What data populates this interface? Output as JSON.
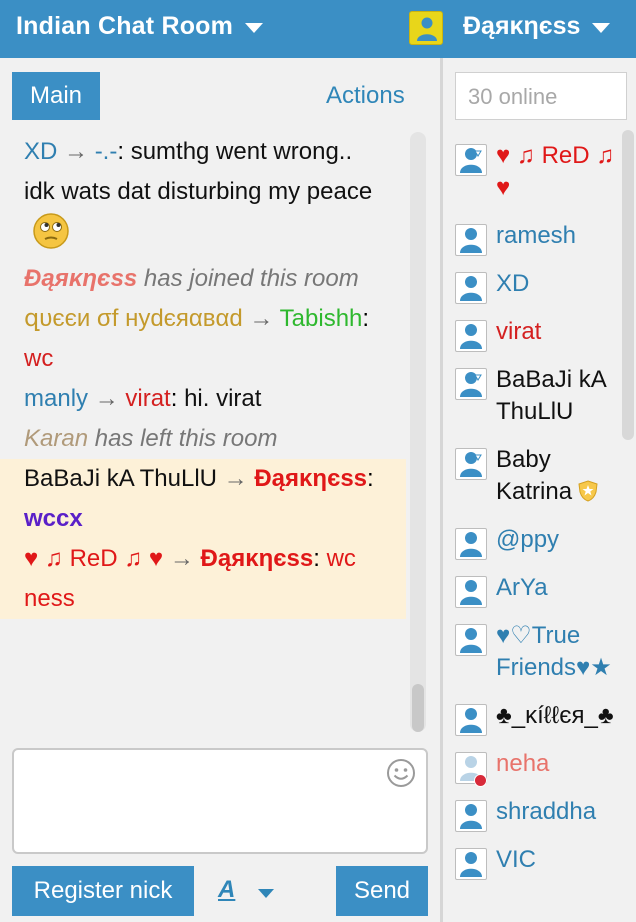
{
  "header": {
    "room_title": "Indian Chat Room",
    "user_name": "Ɖąяκηєѕѕ"
  },
  "tabs": {
    "main": "Main",
    "actions": "Actions"
  },
  "messages": [
    {
      "type": "chat",
      "from": "XD",
      "from_color": "#2f7fb0",
      "to": "-.-",
      "to_color": "#2f7fb0",
      "text": "sumthg went wrong.. idk wats dat disturbing my peace",
      "text_color": "#111111",
      "emoji": "rolling-eyes-emoji"
    },
    {
      "type": "join",
      "nick": "Ɖąяκηєѕѕ",
      "nick_color": "#e8736b",
      "text": "has joined this room"
    },
    {
      "type": "chat",
      "from": "զυєєи σf нуdєяαвαd",
      "from_color": "#c49a2c",
      "to": "Tabishh",
      "to_color": "#2eb82e",
      "text": "wc",
      "text_color": "#d42020"
    },
    {
      "type": "chat",
      "from": "manly",
      "from_color": "#2f7fb0",
      "to": "virat",
      "to_color": "#d42020",
      "text": "hi. virat",
      "text_color": "#111111"
    },
    {
      "type": "leave",
      "nick": "Karan",
      "nick_color": "#b09a7a",
      "text": "has left this room"
    },
    {
      "type": "chat",
      "highlight": true,
      "from": "BaBaJi kA ThuLlU",
      "from_color": "#111111",
      "to": "Ɖąяκηєѕѕ",
      "to_color": "#e01818",
      "text": "wccx",
      "text_color": "#5a20c8"
    },
    {
      "type": "chat",
      "highlight": true,
      "from": "♥ ♫ ReD ♫ ♥",
      "from_color": "#e01818",
      "to": "Ɖąяκηєѕѕ",
      "to_color": "#e01818",
      "text": "wc ness",
      "text_color": "#e01818"
    }
  ],
  "composer": {
    "register_label": "Register nick",
    "format_label": "A",
    "send_label": "Send"
  },
  "online": {
    "placeholder": "30 online"
  },
  "users": [
    {
      "name": "♥ ♫ ReD ♫ ♥",
      "color": "#e01818",
      "icon": "download-avatar"
    },
    {
      "name": "ramesh",
      "color": "#2f7fb0",
      "icon": "person-avatar"
    },
    {
      "name": "XD",
      "color": "#2f7fb0",
      "icon": "person-avatar"
    },
    {
      "name": "virat",
      "color": "#d42020",
      "icon": "person-avatar"
    },
    {
      "name": "BaBaJi kA ThuLlU",
      "color": "#111111",
      "icon": "download-avatar"
    },
    {
      "name": "Baby Katrina",
      "color": "#111111",
      "icon": "download-avatar",
      "badge": "shield-icon"
    },
    {
      "name": "@ppy",
      "color": "#2f7fb0",
      "icon": "person-avatar"
    },
    {
      "name": "ArYa",
      "color": "#2f7fb0",
      "icon": "person-avatar"
    },
    {
      "name": "♥♡True Friends♥★",
      "color": "#2f7fb0",
      "icon": "person-avatar"
    },
    {
      "name": "♣_κíℓℓєя_♣",
      "color": "#111111",
      "icon": "person-avatar"
    },
    {
      "name": "neha",
      "color": "#e8736b",
      "icon": "away-avatar"
    },
    {
      "name": "shraddha",
      "color": "#2f7fb0",
      "icon": "person-avatar"
    },
    {
      "name": "VIC",
      "color": "#2f7fb0",
      "icon": "person-avatar"
    }
  ]
}
